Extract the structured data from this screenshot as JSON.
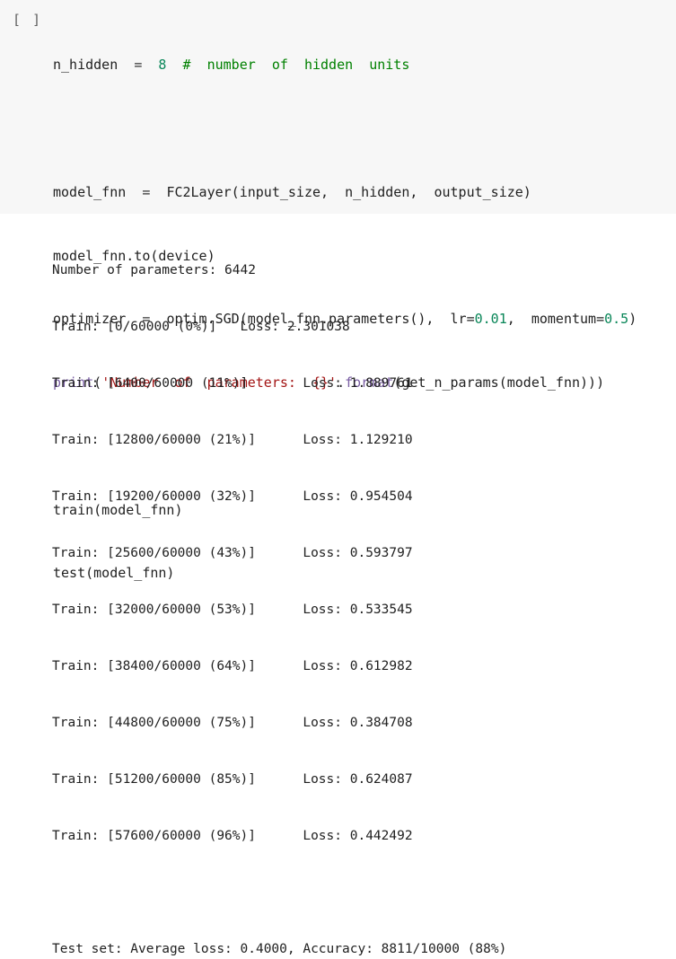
{
  "run_indicator": "[ ]",
  "code": {
    "line1": {
      "name": "n_hidden",
      "eq": "=",
      "val": "8",
      "hash": "#",
      "comment": "number  of  hidden  units"
    },
    "line3": {
      "lhs": "model_fnn",
      "eq": "=",
      "rhs": "FC2Layer(input_size,  n_hidden,  output_size)"
    },
    "line4": "model_fnn.to(device)",
    "line5": {
      "lhs": "optimizer",
      "eq": "=",
      "pre": "optim.SGD(model_fnn.parameters(),  lr=",
      "lr": "0.01",
      "mid": ",  momentum=",
      "momentum": "0.5",
      "post": ")"
    },
    "line6": {
      "print": "print",
      "open": "(",
      "str": "'Number  of  parameters:  {}'",
      "dot": ".",
      "format": "format",
      "post": "(get_n_params(model_fnn)))"
    },
    "line8": "train(model_fnn)",
    "line9": "test(model_fnn)"
  },
  "output_lines": [
    "Number of parameters: 6442",
    "Train: [0/60000 (0%)]   Loss: 2.301038",
    "Train: [6400/60000 (11%)]       Loss: 1.889761",
    "Train: [12800/60000 (21%)]      Loss: 1.129210",
    "Train: [19200/60000 (32%)]      Loss: 0.954504",
    "Train: [25600/60000 (43%)]      Loss: 0.593797",
    "Train: [32000/60000 (53%)]      Loss: 0.533545",
    "Train: [38400/60000 (64%)]      Loss: 0.612982",
    "Train: [44800/60000 (75%)]      Loss: 0.384708",
    "Train: [51200/60000 (85%)]      Loss: 0.624087",
    "Train: [57600/60000 (96%)]      Loss: 0.442492",
    "",
    "Test set: Average loss: 0.4000, Accuracy: 8811/10000 (88%)"
  ],
  "colors": {
    "cell_background": "#f7f7f7",
    "string": "#a31515",
    "number": "#098658",
    "comment": "#008000",
    "builtin": "#795da3"
  }
}
